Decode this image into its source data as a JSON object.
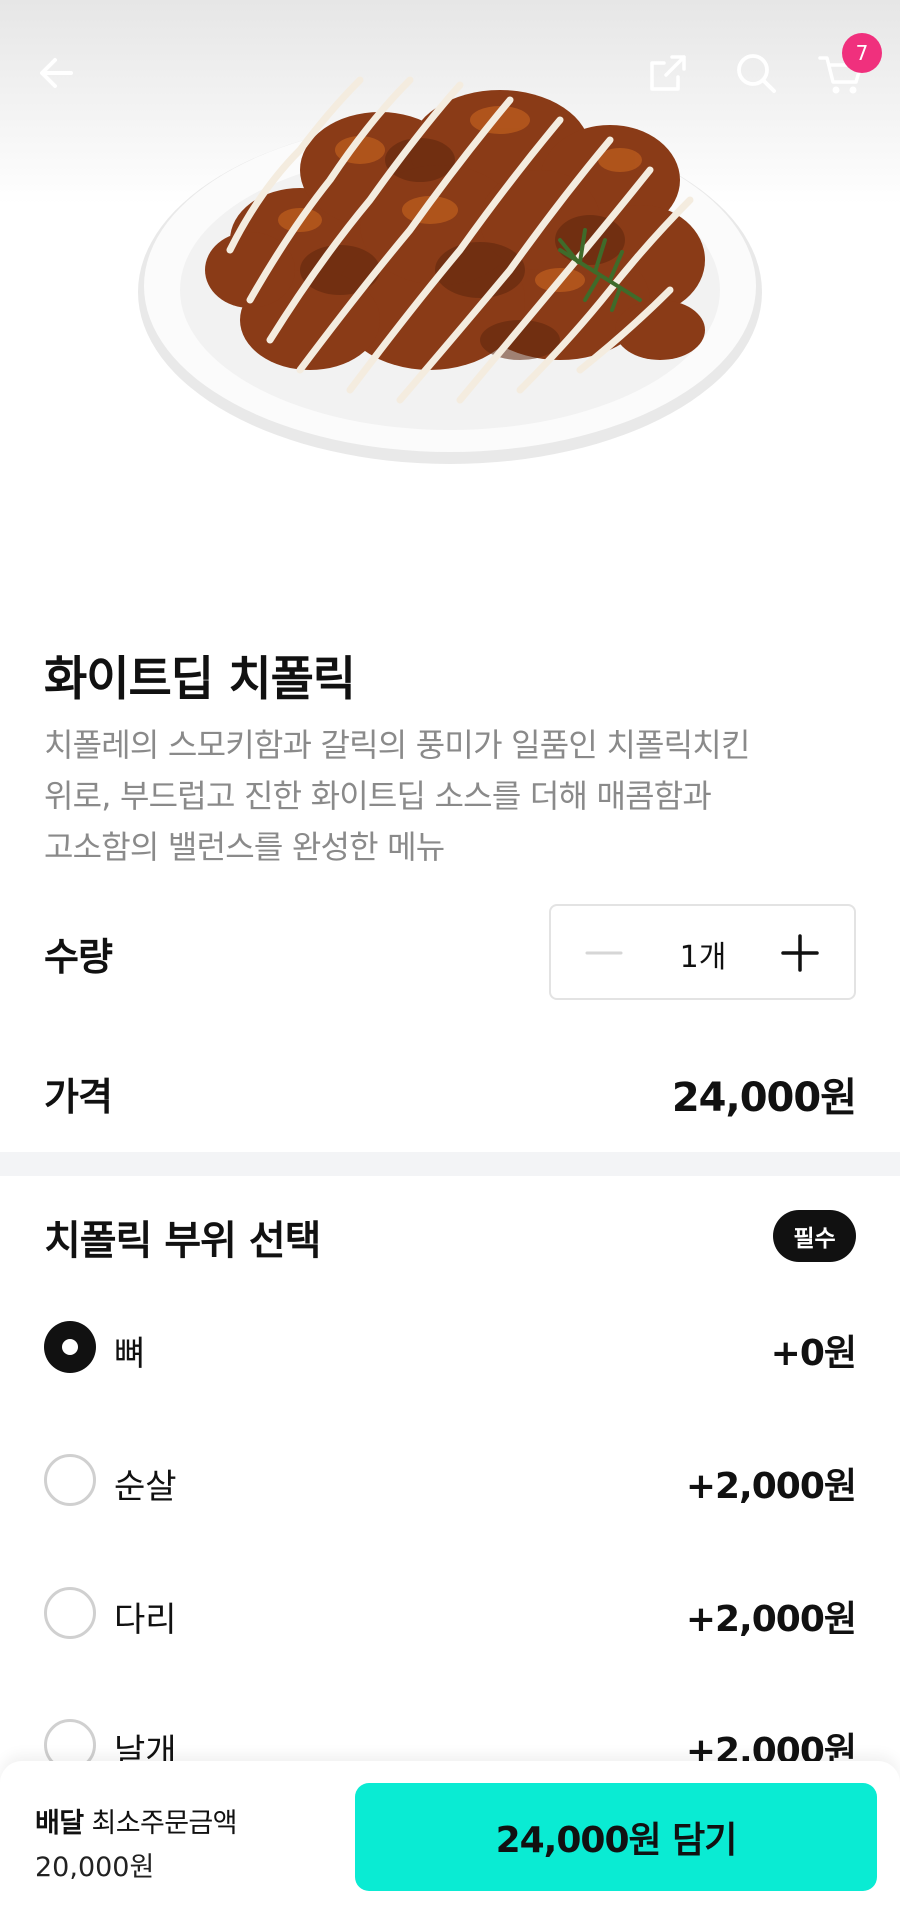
{
  "header": {
    "back_icon": "arrow-left-icon",
    "share_icon": "share-icon",
    "search_icon": "search-icon",
    "cart_icon": "cart-icon",
    "cart_count": "7",
    "badge_color": "#f0307d"
  },
  "product": {
    "name": "화이트딥 치폴릭",
    "description_lines": [
      "치폴레의 스모키함과 갈릭의 풍미가 일품인 치폴릭치킨",
      "위로, 부드럽고 진한 화이트딥 소스를 더해 매콤함과",
      "고소함의 밸런스를 완성한 메뉴"
    ]
  },
  "quantity": {
    "label": "수량",
    "value": "1개"
  },
  "price": {
    "label": "가격",
    "value": "24,000원"
  },
  "part_select": {
    "title": "치폴릭 부위 선택",
    "required_badge": "필수",
    "options": [
      {
        "label": "뼈",
        "price": "+0원",
        "selected": true
      },
      {
        "label": "순살",
        "price": "+2,000원",
        "selected": false
      },
      {
        "label": "다리",
        "price": "+2,000원",
        "selected": false
      },
      {
        "label": "날개",
        "price": "+2,000원",
        "selected": false
      }
    ]
  },
  "bottom": {
    "delivery_label": "배달",
    "min_order_label": "최소주문금액",
    "min_order_value": "20,000원",
    "add_button": "24,000원 담기",
    "accent_color": "#0aebd3"
  }
}
